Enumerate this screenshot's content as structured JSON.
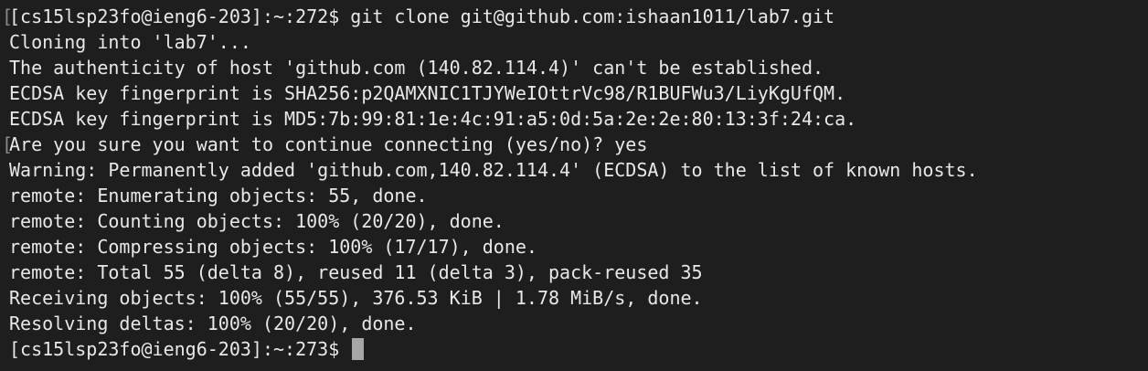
{
  "terminal": {
    "colors": {
      "background": "#1e1e1e",
      "foreground": "#e8e8e8",
      "cursor": "#a6a6a6"
    },
    "lines": [
      {
        "text": "[cs15lsp23fo@ieng6-203]:~:272$ git clone git@github.com:ishaan1011/lab7.git",
        "marker": "["
      },
      {
        "text": "Cloning into 'lab7'..."
      },
      {
        "text": "The authenticity of host 'github.com (140.82.114.4)' can't be established."
      },
      {
        "text": "ECDSA key fingerprint is SHA256:p2QAMXNIC1TJYWeIOttrVc98/R1BUFWu3/LiyKgUfQM."
      },
      {
        "text": "ECDSA key fingerprint is MD5:7b:99:81:1e:4c:91:a5:0d:5a:2e:2e:80:13:3f:24:ca."
      },
      {
        "text": "Are you sure you want to continue connecting (yes/no)? yes",
        "marker": "["
      },
      {
        "text": "Warning: Permanently added 'github.com,140.82.114.4' (ECDSA) to the list of known hosts."
      },
      {
        "text": "remote: Enumerating objects: 55, done."
      },
      {
        "text": "remote: Counting objects: 100% (20/20), done."
      },
      {
        "text": "remote: Compressing objects: 100% (17/17), done."
      },
      {
        "text": "remote: Total 55 (delta 8), reused 11 (delta 3), pack-reused 35"
      },
      {
        "text": "Receiving objects: 100% (55/55), 376.53 KiB | 1.78 MiB/s, done."
      },
      {
        "text": "Resolving deltas: 100% (20/20), done."
      }
    ],
    "prompt": "[cs15lsp23fo@ieng6-203]:~:273$ "
  }
}
